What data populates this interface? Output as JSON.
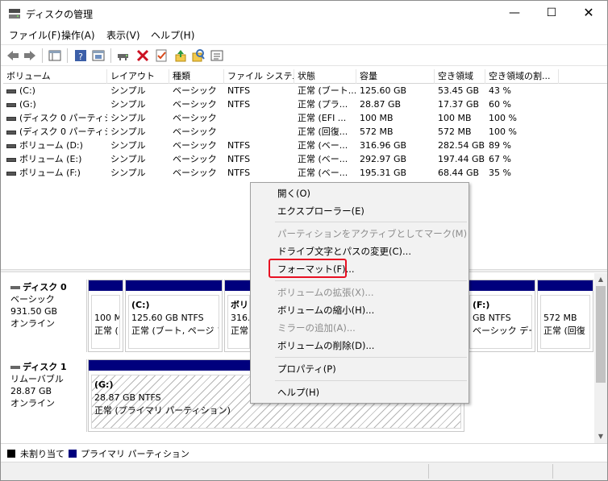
{
  "window": {
    "title": "ディスクの管理",
    "controls": {
      "minimize": "—",
      "maximize": "☐",
      "close": "✕"
    }
  },
  "menubar": [
    "ファイル(F)",
    "操作(A)",
    "表示(V)",
    "ヘルプ(H)"
  ],
  "toolbar_icons": [
    "back-icon",
    "forward-icon",
    "properties-icon",
    "help-icon",
    "console-tree-icon",
    "connect-drive-icon",
    "delete-icon",
    "check-icon",
    "export-list-icon",
    "search-icon",
    "view-icon"
  ],
  "colors": {
    "primary_partition": "#00007d",
    "unallocated": "#000000",
    "delete_icon": "#cc1122",
    "highlight": "#e81123"
  },
  "volumes_table": {
    "headers": [
      "ボリューム",
      "レイアウト",
      "種類",
      "ファイル システム",
      "状態",
      "容量",
      "空き領域",
      "空き領域の割..."
    ],
    "rows": [
      [
        "(C:)",
        "シンプル",
        "ベーシック",
        "NTFS",
        "正常 (ブート...",
        "125.60 GB",
        "53.45 GB",
        "43 %"
      ],
      [
        "(G:)",
        "シンプル",
        "ベーシック",
        "NTFS",
        "正常 (プラ...",
        "28.87 GB",
        "17.37 GB",
        "60 %"
      ],
      [
        "(ディスク 0 パーティシ...",
        "シンプル",
        "ベーシック",
        "",
        "正常 (EFI ...",
        "100 MB",
        "100 MB",
        "100 %"
      ],
      [
        "(ディスク 0 パーティシ...",
        "シンプル",
        "ベーシック",
        "",
        "正常 (回復...",
        "572 MB",
        "572 MB",
        "100 %"
      ],
      [
        "ボリューム (D:)",
        "シンプル",
        "ベーシック",
        "NTFS",
        "正常 (ベー...",
        "316.96 GB",
        "282.54 GB",
        "89 %"
      ],
      [
        "ボリューム (E:)",
        "シンプル",
        "ベーシック",
        "NTFS",
        "正常 (ベー...",
        "292.97 GB",
        "197.44 GB",
        "67 %"
      ],
      [
        "ボリューム (F:)",
        "シンプル",
        "ベーシック",
        "NTFS",
        "正常 (ベー...",
        "195.31 GB",
        "68.44 GB",
        "35 %"
      ]
    ]
  },
  "disks": [
    {
      "name": "ディスク 0",
      "type": "ベーシック",
      "size": "931.50 GB",
      "status": "オンライン",
      "partitions": [
        {
          "l1": "",
          "l2": "100 M",
          "l3": "正常 ("
        },
        {
          "l1": "(C:)",
          "l2": "125.60 GB NTFS",
          "l3": "正常 (ブート, ページ ファ"
        },
        {
          "l1": "ボリ",
          "l2": "316.9",
          "l3": "正常"
        },
        {
          "l1": "",
          "l2": "",
          "l3": ""
        },
        {
          "l1": "(F:)",
          "l2": "GB NTFS",
          "l3": "ベーシック データ)"
        },
        {
          "l1": "",
          "l2": "572 MB",
          "l3": "正常 (回復"
        }
      ]
    },
    {
      "name": "ディスク 1",
      "type": "リムーバブル",
      "size": "28.87 GB",
      "status": "オンライン",
      "partitions": [
        {
          "l1": "(G:)",
          "l2": "28.87 GB NTFS",
          "l3": "正常 (プライマリ パーティション)"
        }
      ]
    }
  ],
  "legend": [
    "未割り当て",
    "プライマリ パーティション"
  ],
  "context_menu": {
    "items": [
      {
        "label": "開く(O)",
        "enabled": true
      },
      {
        "label": "エクスプローラー(E)",
        "enabled": true
      },
      {
        "label": "パーティションをアクティブとしてマーク(M)",
        "enabled": false
      },
      {
        "label": "ドライブ文字とパスの変更(C)...",
        "enabled": true
      },
      {
        "label": "フォーマット(F)...",
        "enabled": true
      },
      {
        "label": "ボリュームの拡張(X)...",
        "enabled": false
      },
      {
        "label": "ボリュームの縮小(H)...",
        "enabled": true
      },
      {
        "label": "ミラーの追加(A)...",
        "enabled": false
      },
      {
        "label": "ボリュームの削除(D)...",
        "enabled": true
      },
      {
        "label": "プロパティ(P)",
        "enabled": true
      },
      {
        "label": "ヘルプ(H)",
        "enabled": true
      }
    ]
  }
}
